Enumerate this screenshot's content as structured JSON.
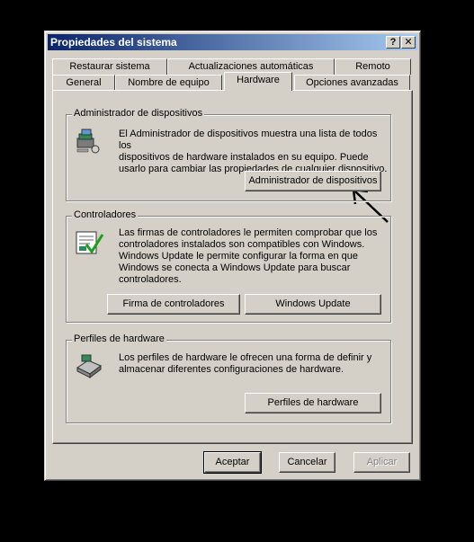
{
  "window": {
    "title": "Propiedades del sistema",
    "help_glyph": "?",
    "close_glyph": "✕"
  },
  "tabs": {
    "row1": [
      "Restaurar sistema",
      "Actualizaciones automáticas",
      "Remoto"
    ],
    "row2": [
      "General",
      "Nombre de equipo",
      "Hardware",
      "Opciones avanzadas"
    ],
    "active": "Hardware"
  },
  "device_manager": {
    "title": "Administrador de dispositivos",
    "lines": [
      "El Administrador de dispositivos muestra una lista de todos los",
      "dispositivos de hardware instalados en su equipo. Puede",
      "usarlo para cambiar las propiedades de cualquier dispositivo."
    ],
    "button": "Administrador de dispositivos",
    "icon": "device-manager-icon"
  },
  "drivers": {
    "title": "Controladores",
    "lines": [
      "Las firmas de controladores le permiten comprobar que los",
      "controladores instalados son compatibles con Windows.",
      "Windows Update le permite configurar la forma en que",
      "Windows se conecta a Windows Update para buscar",
      "controladores."
    ],
    "button_signing": "Firma de controladores",
    "button_update": "Windows Update",
    "icon": "driver-signing-icon"
  },
  "profiles": {
    "title": "Perfiles de hardware",
    "lines": [
      "Los perfiles de hardware le ofrecen una forma de definir y",
      "almacenar diferentes configuraciones de hardware."
    ],
    "button": "Perfiles de hardware",
    "icon": "hardware-profiles-icon"
  },
  "footer": {
    "ok": "Aceptar",
    "cancel": "Cancelar",
    "apply": "Aplicar"
  },
  "colors": {
    "face": "#d4d0c8",
    "title_start": "#0a246a",
    "title_end": "#a6caf0",
    "background": "#000000"
  }
}
